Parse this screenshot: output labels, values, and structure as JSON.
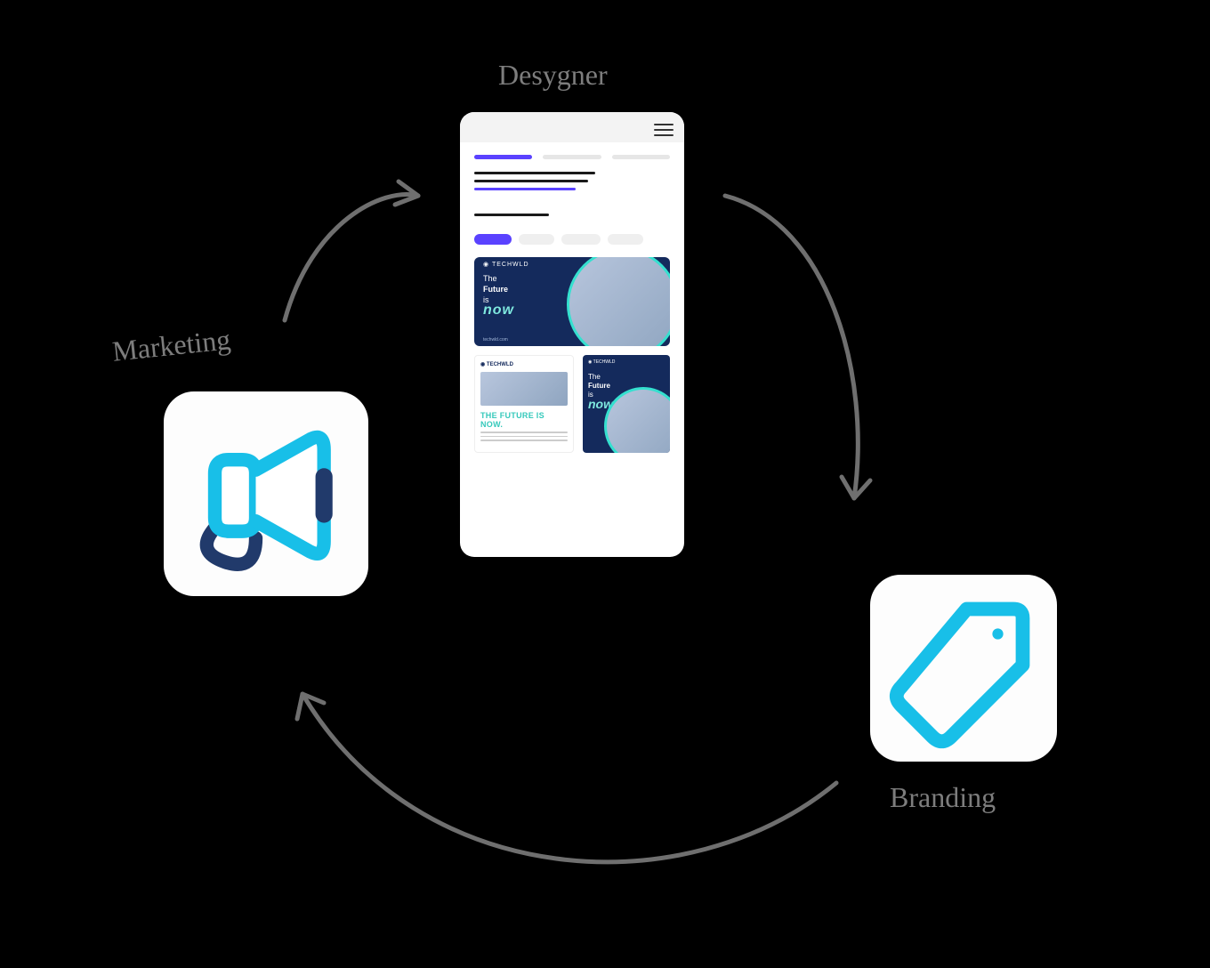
{
  "labels": {
    "top": "Desygner",
    "left": "Marketing",
    "right": "Branding"
  },
  "template": {
    "brand": "TECHWLD",
    "line1": "The",
    "line2": "Future",
    "line3": "is",
    "now": "now",
    "url": "techwld.com",
    "flyerHead": "THE\nFUTURE\nIS NOW."
  },
  "colors": {
    "accent": "#18bfe8",
    "navy": "#142a5c",
    "handle": "#213a6b"
  }
}
